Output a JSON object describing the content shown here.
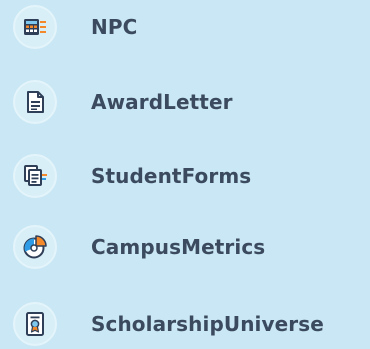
{
  "menu": {
    "items": [
      {
        "label": "NPC",
        "icon": "calculator-icon"
      },
      {
        "label": "AwardLetter",
        "icon": "document-icon"
      },
      {
        "label": "StudentForms",
        "icon": "forms-icon"
      },
      {
        "label": "CampusMetrics",
        "icon": "pie-chart-icon"
      },
      {
        "label": "ScholarshipUniverse",
        "icon": "certificate-icon"
      }
    ]
  },
  "colors": {
    "background": "#c9e7f4",
    "icon_circle": "#d9eff8",
    "label_text": "#3b4a5e",
    "icon_dark": "#2f3f57",
    "icon_orange": "#f4892b",
    "icon_blue": "#2e9be6",
    "icon_light_blue": "#7ec8f0"
  }
}
